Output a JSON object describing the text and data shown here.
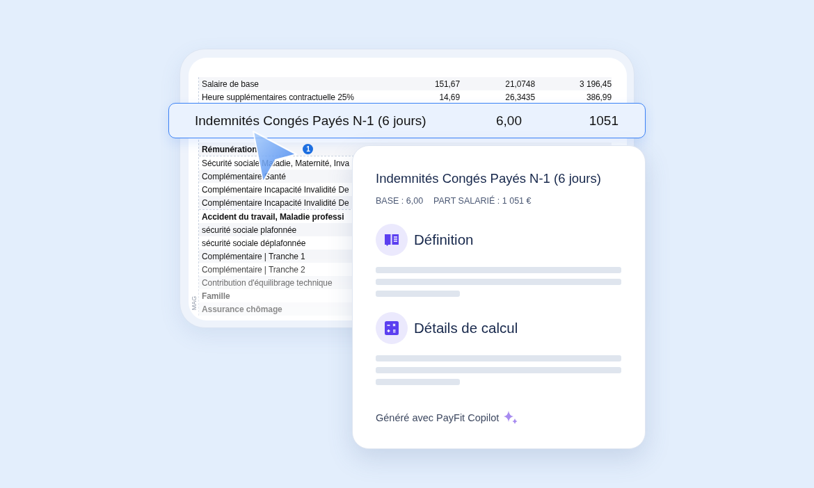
{
  "sheet": {
    "rows": [
      {
        "kind": "line",
        "label": "Salaire de base",
        "values": [
          "151,67",
          "21,0748",
          "3 196,45"
        ]
      },
      {
        "kind": "line",
        "label": "Heure supplémentaires contractuelle 25%",
        "values": [
          "14,69",
          "26,3435",
          "386,99"
        ]
      },
      {
        "kind": "gap"
      },
      {
        "kind": "section",
        "label": "Rémunération",
        "badge": "1"
      },
      {
        "kind": "line",
        "label": "Sécurité sociale Maladie, Maternité, Inva"
      },
      {
        "kind": "line",
        "label": "Complémentaire Santé"
      },
      {
        "kind": "line",
        "label": "Complémentaire Incapacité Invalidité De"
      },
      {
        "kind": "line",
        "label": "Complémentaire Incapacité Invalidité De"
      },
      {
        "kind": "section",
        "label": "Accident du travail, Maladie professi"
      },
      {
        "kind": "line",
        "label": "sécurité sociale plafonnée"
      },
      {
        "kind": "line",
        "label": "sécurité sociale déplafonnée"
      },
      {
        "kind": "line",
        "label": "Complémentaire | Tranche 1"
      },
      {
        "kind": "line",
        "label": "Complémentaire | Tranche 2"
      },
      {
        "kind": "line",
        "label": "Contribution d'équilibrage technique"
      },
      {
        "kind": "section",
        "label": "Famille"
      },
      {
        "kind": "section",
        "label": "Assurance chômage"
      }
    ],
    "side_label": "MAG"
  },
  "highlight": {
    "label": "Indemnités Congés Payés N-1 (6 jours)",
    "base": "6,00",
    "amount": "1051"
  },
  "panel": {
    "title": "Indemnités Congés Payés N-1 (6 jours)",
    "meta": [
      "BASE : 6,00",
      "PART SALARIÉ : 1 051 €"
    ],
    "sections": [
      {
        "kind": "definition",
        "heading": "Définition"
      },
      {
        "kind": "calculation",
        "heading": "Détails de calcul"
      }
    ],
    "footer": "Généré avec PayFit Copilot"
  }
}
